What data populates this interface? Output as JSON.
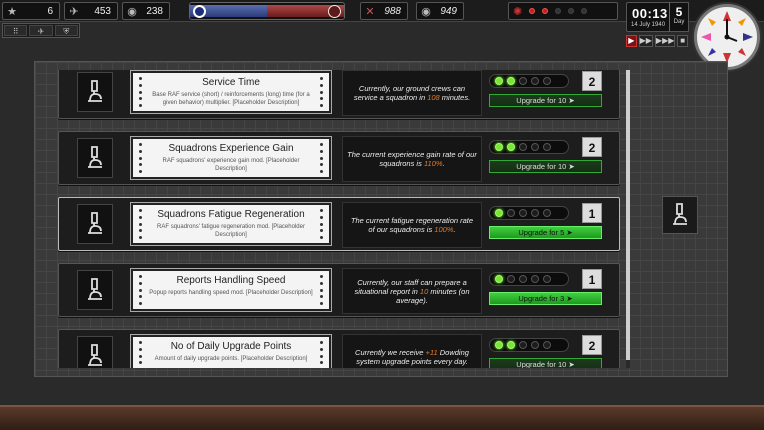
{
  "topbar": {
    "stats": [
      {
        "icon": "star-icon",
        "value": "6"
      },
      {
        "icon": "aircraft-icon",
        "value": "453"
      },
      {
        "icon": "pilot-icon",
        "value": "238"
      },
      {
        "icon": "enemy-aircraft-icon",
        "value": "988"
      },
      {
        "icon": "enemy-pilot-icon",
        "value": "949"
      }
    ],
    "balance_blue_fraction": 0.5
  },
  "subbar": [
    "⠿",
    "✈",
    "⛨"
  ],
  "time": {
    "clock": "00:13",
    "date": "14 July 1940",
    "day_number": "5",
    "day_label": "Day"
  },
  "speed_controls": [
    "▶",
    "▶▶",
    "▶▶▶",
    "■"
  ],
  "upgrades": [
    {
      "title": "Service Time",
      "desc": "Base RAF service (short) / reinforcements (long) time (for a given behavior) multiplier. [Placeholder Description]",
      "info_pre": "Currently, our ground crews can service a squadron in ",
      "info_hl": "108",
      "info_post": " minutes.",
      "level_pips": 2,
      "level": "2",
      "button": "Upgrade for 10  ➤",
      "bright": false
    },
    {
      "title": "Squadrons Experience Gain",
      "desc": "RAF squadrons' experience gain mod. [Placeholder Description]",
      "info_pre": "The current experience gain rate of our squadrons is ",
      "info_hl": "110%",
      "info_post": ".",
      "level_pips": 2,
      "level": "2",
      "button": "Upgrade for 10  ➤",
      "bright": false
    },
    {
      "title": "Squadrons Fatigue Regeneration",
      "desc": "RAF squadrons' fatigue regeneration mod. [Placeholder Description]",
      "info_pre": "The current fatigue regeneration rate of our squadrons is ",
      "info_hl": "100%",
      "info_post": ".",
      "level_pips": 1,
      "level": "1",
      "button": "Upgrade for 5  ➤",
      "bright": true
    },
    {
      "title": "Reports Handling Speed",
      "desc": "Popup reports handling speed mod. [Placeholder Description]",
      "info_pre": "Currently, our staff can prepare a situational report in ",
      "info_hl": "10",
      "info_post": " minutes (on average).",
      "level_pips": 1,
      "level": "1",
      "button": "Upgrade for 3  ➤",
      "bright": true
    },
    {
      "title": "No of Daily Upgrade Points",
      "desc": "Amount of daily upgrade points. [Placeholder Description]",
      "info_pre": "Currently we receive ",
      "info_hl": "+11",
      "info_post": " Dowding system upgrade points every day.",
      "level_pips": 2,
      "level": "2",
      "button": "Upgrade for 10  ➤",
      "bright": false
    }
  ]
}
